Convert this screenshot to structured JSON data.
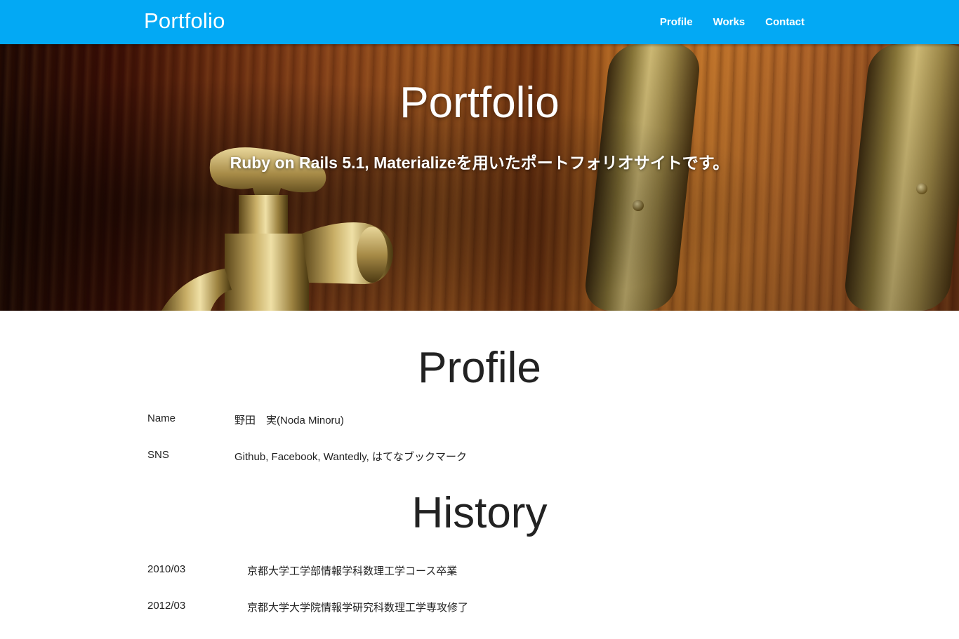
{
  "nav": {
    "brand": "Portfolio",
    "links": [
      "Profile",
      "Works",
      "Contact"
    ]
  },
  "hero": {
    "title": "Portfolio",
    "subtitle": "Ruby on Rails 5.1, Materializeを用いたポートフォリオサイトです。"
  },
  "profile": {
    "title": "Profile",
    "rows": [
      {
        "label": "Name",
        "value": "野田　実(Noda Minoru)"
      }
    ],
    "sns": {
      "label": "SNS",
      "links": [
        "Github",
        "Facebook",
        "Wantedly",
        "はてなブックマーク"
      ],
      "separator": ", "
    }
  },
  "history": {
    "title": "History",
    "rows": [
      {
        "date": "2010/03",
        "text": "京都大学工学部情報学科数理工学コース卒業"
      },
      {
        "date": "2012/03",
        "text": "京都大学大学院情報学研究科数理工学専攻修了"
      }
    ]
  },
  "colors": {
    "nav": "#03a9f4"
  }
}
